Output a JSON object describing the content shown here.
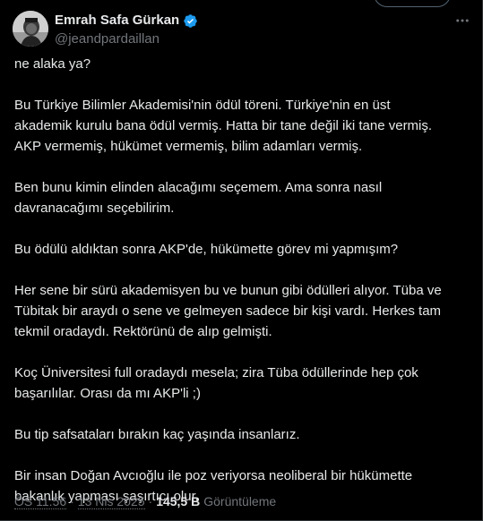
{
  "author": {
    "display_name": "Emrah Safa Gürkan",
    "handle": "@jeandpardaillan",
    "verified_badge_icon": "verified-badge-icon",
    "badge_color": "#1d9bf0"
  },
  "tweet": {
    "paragraphs": [
      [
        "ne alaka ya?"
      ],
      [
        "Bu Türkiye Bilimler Akademisi'nin ödül töreni. Türkiye'nin en üst",
        "akademik kurulu bana ödül vermiş. Hatta bir tane değil iki tane vermiş.",
        "AKP vermemiş, hükümet vermemiş, bilim adamları vermiş."
      ],
      [
        "Ben bunu kimin elinden alacağımı seçemem. Ama sonra nasıl",
        "davranacağımı seçebilirim."
      ],
      [
        "Bu ödülü aldıktan sonra AKP'de, hükümette görev mi yapmışım?"
      ],
      [
        "Her sene bir sürü akademisyen bu ve bunun gibi ödülleri alıyor. Tüba ve",
        "Tübitak bir araydı o sene ve gelmeyen sadece bir kişi vardı. Herkes tam",
        "tekmil oradaydı. Rektörünü de alıp gelmişti."
      ],
      [
        "Koç Üniversitesi full oradaydı mesela; zira Tüba ödüllerinde hep çok",
        "başarılılar. Orası da mı AKP'li ;)"
      ],
      [
        "Bu tip safsataları bırakın kaç yaşında insanlarız."
      ],
      [
        "Bir insan Doğan Avcıoğlu ile poz veriyorsa neoliberal bir hükümette",
        "bakanlık yapması şaşırtıcı olur."
      ]
    ]
  },
  "meta": {
    "time": "ÖS 11:56",
    "separator": "·",
    "date": "13 Nis 2025",
    "views_count": "145,5 B",
    "views_label": "Görüntüleme"
  },
  "icons": {
    "more": "more-options-icon",
    "avatar": "avatar-image"
  },
  "colors": {
    "background": "#000000",
    "text_primary": "#e7e9ea",
    "text_secondary": "#71767b",
    "border": "#2f3336",
    "verified_blue": "#1d9bf0"
  }
}
